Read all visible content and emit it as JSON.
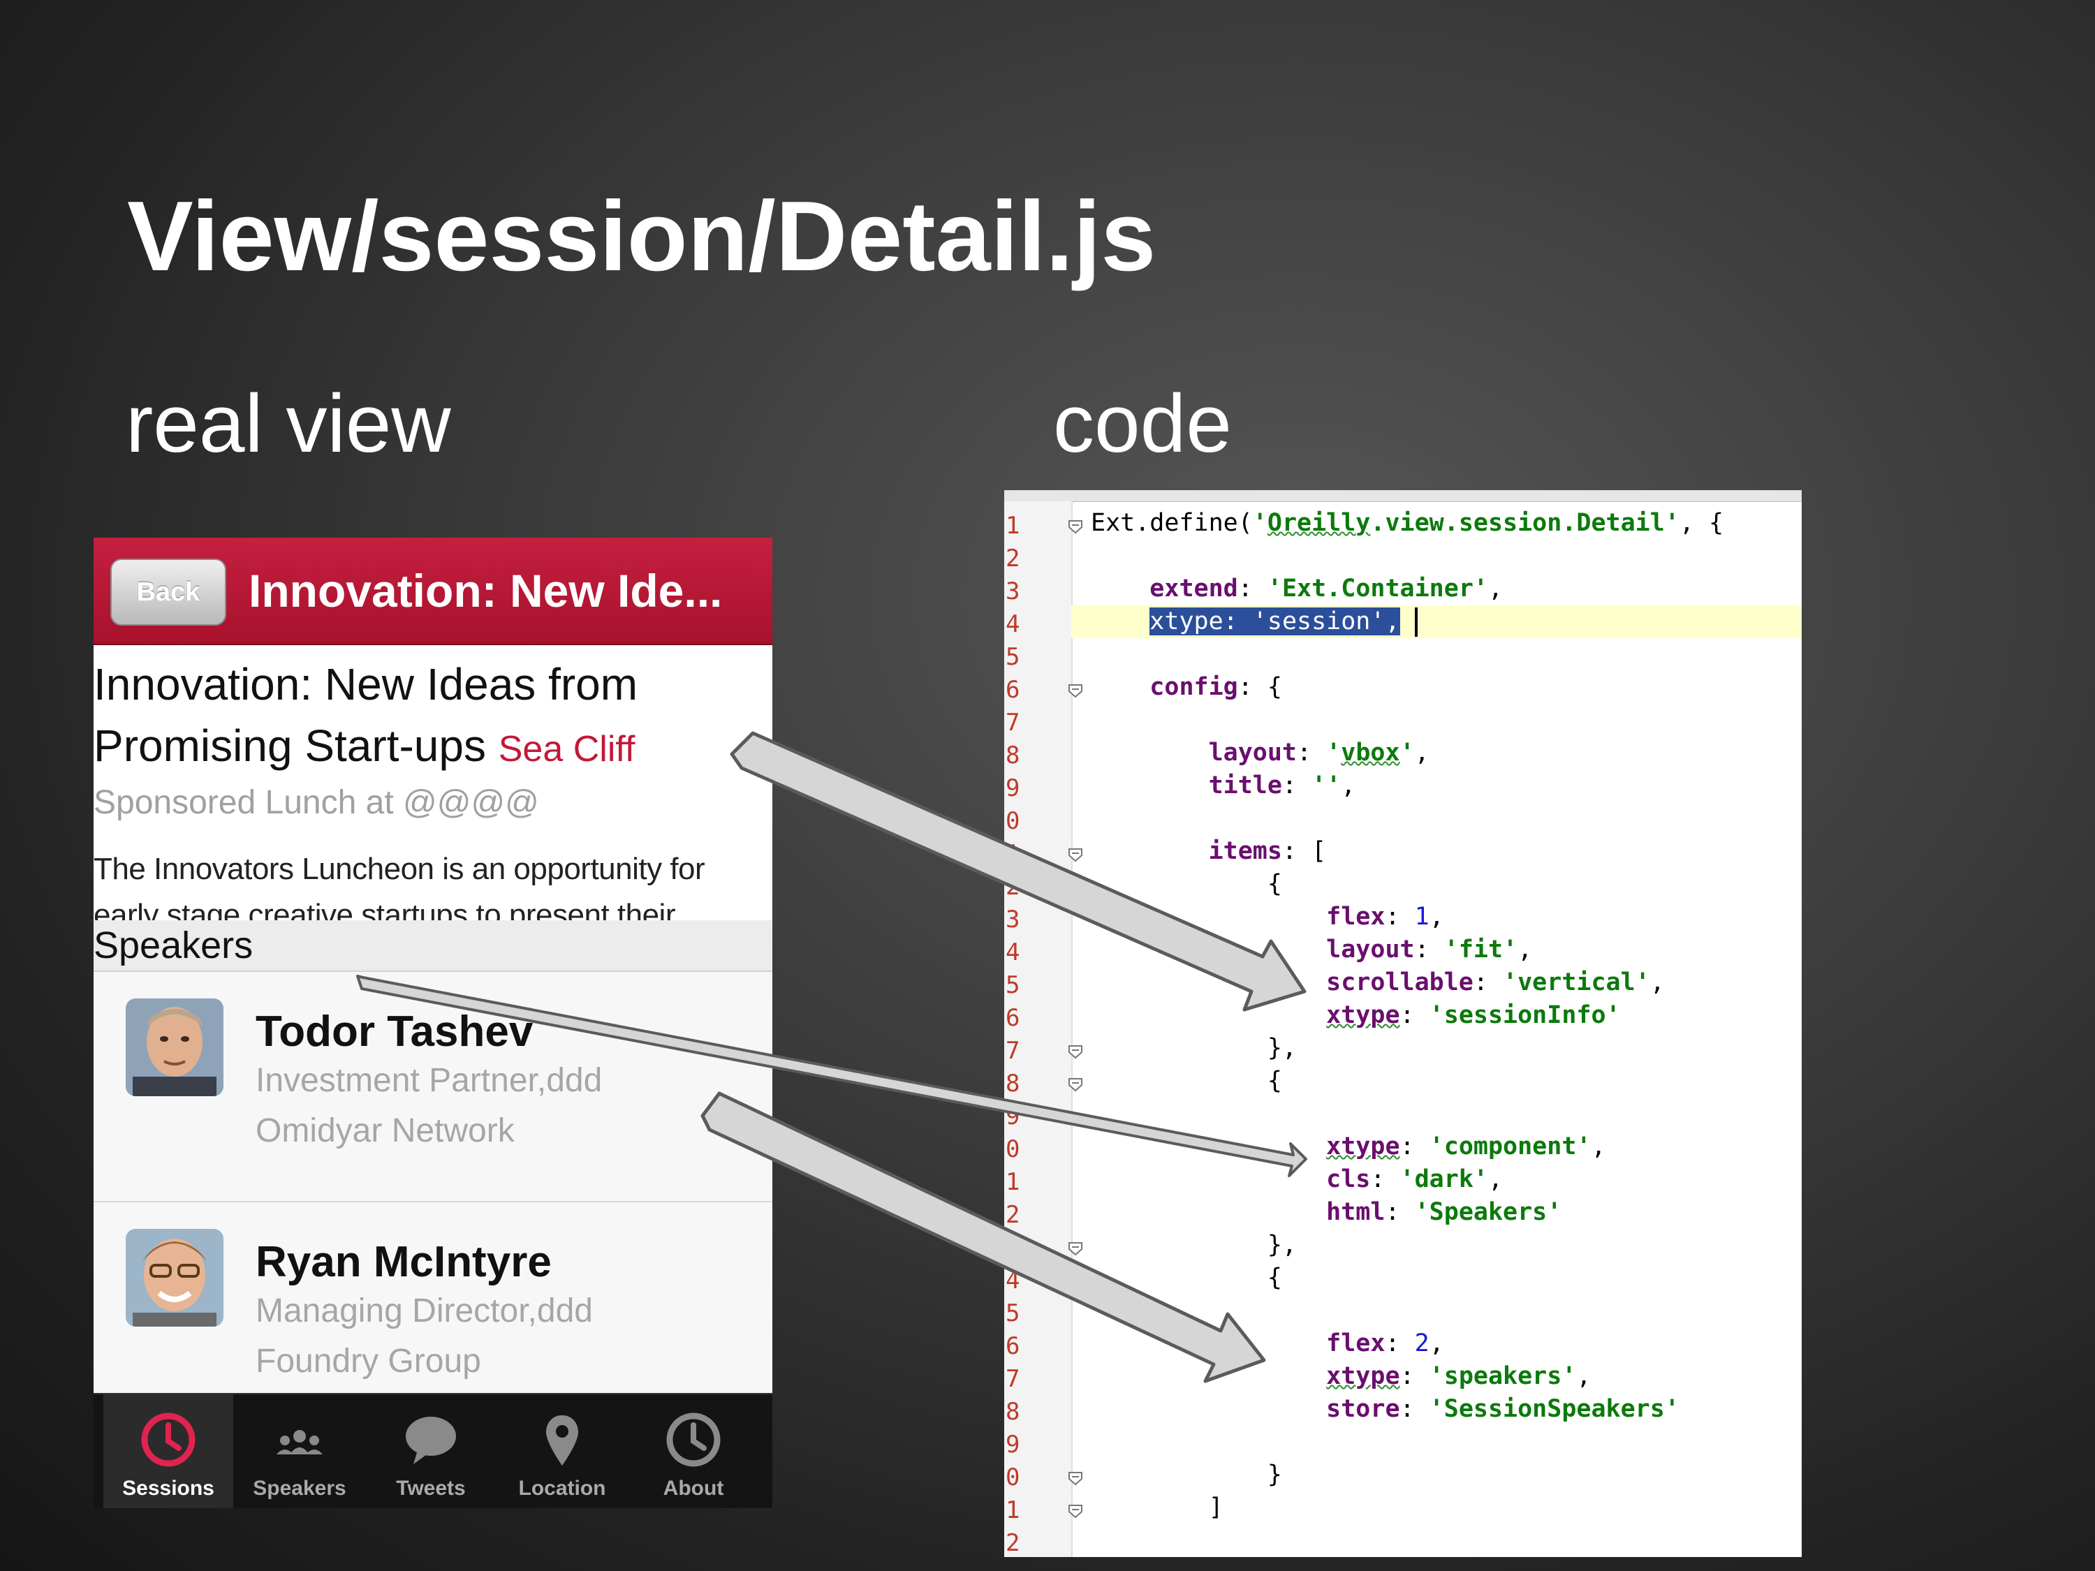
{
  "slide": {
    "title": "View/session/Detail.js",
    "left_label": "real view",
    "right_label": "code"
  },
  "phone": {
    "back_label": "Back",
    "nav_title": "Innovation: New Ide...",
    "session_title": "Innovation: New Ideas from Promising Start-ups",
    "room": "Sea Cliff",
    "subtitle": "Sponsored Lunch at @@@@",
    "description": "The Innovators Luncheon is an opportunity for early stage creative startups to present their",
    "speakers_header": "Speakers",
    "speakers": [
      {
        "name": "Todor Tashev",
        "title": "Investment Partner,ddd",
        "org": "Omidyar Network"
      },
      {
        "name": "Ryan McIntyre",
        "title": "Managing Director,ddd",
        "org": "Foundry Group"
      }
    ],
    "tabs": [
      {
        "label": "Sessions",
        "icon": "clock-icon",
        "active": true
      },
      {
        "label": "Speakers",
        "icon": "people-icon",
        "active": false
      },
      {
        "label": "Tweets",
        "icon": "speech-bubble-icon",
        "active": false
      },
      {
        "label": "Location",
        "icon": "map-pin-icon",
        "active": false
      },
      {
        "label": "About",
        "icon": "clock-icon",
        "active": false
      }
    ]
  },
  "code": {
    "line_numbers": [
      "1",
      "2",
      "3",
      "4",
      "5",
      "6",
      "7",
      "8",
      "9",
      "0",
      "1",
      "2",
      "3",
      "4",
      "5",
      "6",
      "7",
      "8",
      "9",
      "0",
      "1",
      "2",
      "3",
      "4",
      "5",
      "6",
      "7",
      "8",
      "9",
      "0",
      "1",
      "2"
    ],
    "lines": [
      [
        [
          "p",
          "Ext.define("
        ],
        [
          "s",
          "'"
        ],
        [
          "sw",
          "Oreilly"
        ],
        [
          "s",
          ".view.session.Detail'"
        ],
        [
          "p",
          ", {"
        ]
      ],
      [],
      [
        [
          "p",
          "    "
        ],
        [
          "k",
          "extend"
        ],
        [
          "p",
          ": "
        ],
        [
          "s",
          "'Ext.Container'"
        ],
        [
          "p",
          ","
        ]
      ],
      [
        [
          "p",
          "    "
        ],
        [
          "SEL",
          "xtype: 'session',"
        ]
      ],
      [],
      [
        [
          "p",
          "    "
        ],
        [
          "k",
          "config"
        ],
        [
          "p",
          ": {"
        ]
      ],
      [],
      [
        [
          "p",
          "        "
        ],
        [
          "k",
          "layout"
        ],
        [
          "p",
          ": "
        ],
        [
          "s",
          "'"
        ],
        [
          "sw",
          "vbox"
        ],
        [
          "s",
          "'"
        ],
        [
          "p",
          ","
        ]
      ],
      [
        [
          "p",
          "        "
        ],
        [
          "k",
          "title"
        ],
        [
          "p",
          ": "
        ],
        [
          "s",
          "''"
        ],
        [
          "p",
          ","
        ]
      ],
      [],
      [
        [
          "p",
          "        "
        ],
        [
          "k",
          "items"
        ],
        [
          "p",
          ": ["
        ]
      ],
      [
        [
          "p",
          "            {"
        ]
      ],
      [
        [
          "p",
          "                "
        ],
        [
          "k",
          "flex"
        ],
        [
          "p",
          ": "
        ],
        [
          "n",
          "1"
        ],
        [
          "p",
          ","
        ]
      ],
      [
        [
          "p",
          "                "
        ],
        [
          "k",
          "layout"
        ],
        [
          "p",
          ": "
        ],
        [
          "s",
          "'fit'"
        ],
        [
          "p",
          ","
        ]
      ],
      [
        [
          "p",
          "                "
        ],
        [
          "k",
          "scrollable"
        ],
        [
          "p",
          ": "
        ],
        [
          "s",
          "'vertical'"
        ],
        [
          "p",
          ","
        ]
      ],
      [
        [
          "p",
          "                "
        ],
        [
          "kw",
          "xtype"
        ],
        [
          "p",
          ": "
        ],
        [
          "s",
          "'sessionInfo'"
        ]
      ],
      [
        [
          "p",
          "            },"
        ]
      ],
      [
        [
          "p",
          "            {"
        ]
      ],
      [],
      [
        [
          "p",
          "                "
        ],
        [
          "kw",
          "xtype"
        ],
        [
          "p",
          ": "
        ],
        [
          "s",
          "'component'"
        ],
        [
          "p",
          ","
        ]
      ],
      [
        [
          "p",
          "                "
        ],
        [
          "k",
          "cls"
        ],
        [
          "p",
          ": "
        ],
        [
          "s",
          "'dark'"
        ],
        [
          "p",
          ","
        ]
      ],
      [
        [
          "p",
          "                "
        ],
        [
          "k",
          "html"
        ],
        [
          "p",
          ": "
        ],
        [
          "s",
          "'Speakers'"
        ]
      ],
      [
        [
          "p",
          "            },"
        ]
      ],
      [
        [
          "p",
          "            {"
        ]
      ],
      [],
      [
        [
          "p",
          "                "
        ],
        [
          "k",
          "flex"
        ],
        [
          "p",
          ": "
        ],
        [
          "n",
          "2"
        ],
        [
          "p",
          ","
        ]
      ],
      [
        [
          "p",
          "                "
        ],
        [
          "kw",
          "xtype"
        ],
        [
          "p",
          ": "
        ],
        [
          "s",
          "'speakers'"
        ],
        [
          "p",
          ","
        ]
      ],
      [
        [
          "p",
          "                "
        ],
        [
          "k",
          "store"
        ],
        [
          "p",
          ": "
        ],
        [
          "s",
          "'SessionSpeakers'"
        ]
      ],
      [],
      [
        [
          "p",
          "            }"
        ]
      ],
      [
        [
          "p",
          "        ]"
        ]
      ],
      [],
      [
        [
          "p",
          "    }"
        ]
      ],
      [
        [
          "p",
          "});"
        ]
      ]
    ]
  },
  "colors": {
    "accent_red": "#c41838",
    "keyword": "#6a0f6e",
    "string": "#0b7a0b",
    "number": "#1a1ad4",
    "selection": "#2b4f9a"
  }
}
